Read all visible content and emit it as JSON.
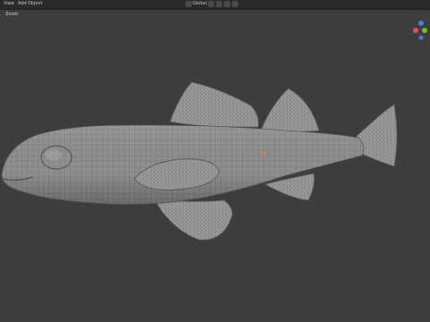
{
  "header": {
    "menu": [
      "View",
      "Add",
      "Object"
    ],
    "transform_label": "Global"
  },
  "viewport": {
    "mode_label": "Zoom"
  },
  "gizmo": {
    "axis_x_color": "#e84a5f",
    "axis_y_color": "#6ec22c",
    "axis_z_color": "#3d7fe6",
    "background": "#3d3d3d"
  },
  "colors": {
    "header_bg": "#2a2a2a",
    "viewport_bg": "#3d3d3d",
    "mesh_fill": "#8e8e8e",
    "wire_color": "#6a6a6a"
  },
  "icons": [
    "move-icon",
    "snap-icon",
    "proportional-icon",
    "overlay-icon",
    "shading-icon"
  ]
}
